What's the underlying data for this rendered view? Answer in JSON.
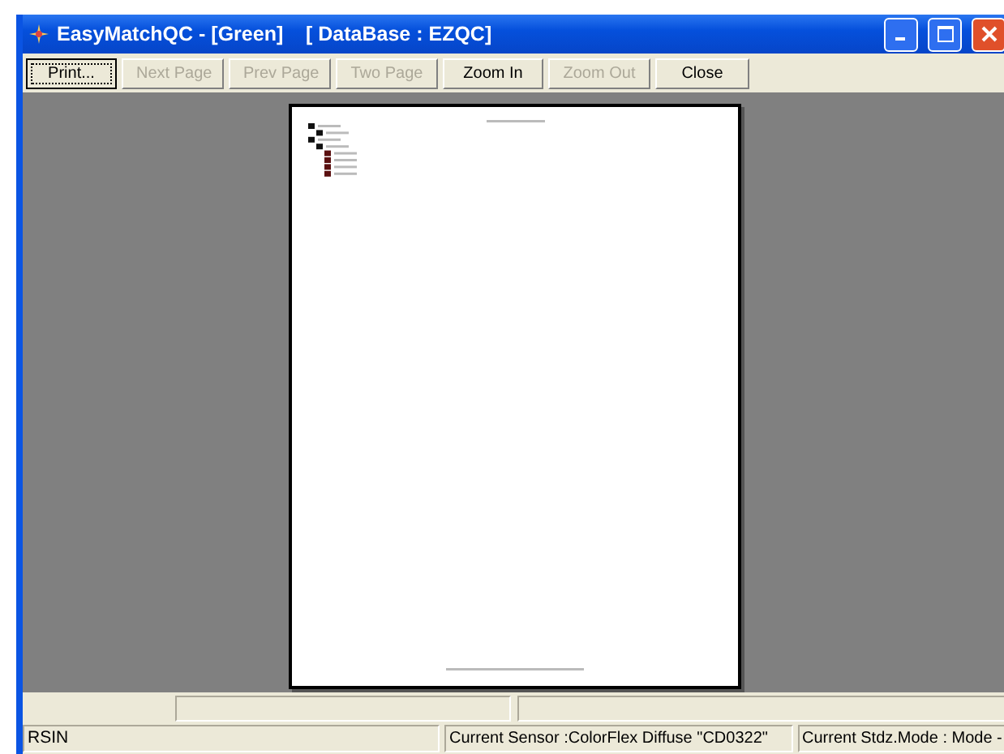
{
  "window": {
    "title": "EasyMatchQC - [Green]    [ DataBase : EZQC]"
  },
  "toolbar": [
    {
      "label": "Print...",
      "disabled": false,
      "focused": true
    },
    {
      "label": "Next Page",
      "disabled": true,
      "focused": false
    },
    {
      "label": "Prev Page",
      "disabled": true,
      "focused": false
    },
    {
      "label": "Two Page",
      "disabled": true,
      "focused": false
    },
    {
      "label": "Zoom In",
      "disabled": false,
      "focused": false
    },
    {
      "label": "Zoom Out",
      "disabled": true,
      "focused": false
    },
    {
      "label": "Close",
      "disabled": false,
      "focused": false
    }
  ],
  "status_bar": [
    "RSIN",
    "Current Sensor :ColorFlex Diffuse \"CD0322\"",
    "Current Stdz.Mode :  Mode -"
  ]
}
